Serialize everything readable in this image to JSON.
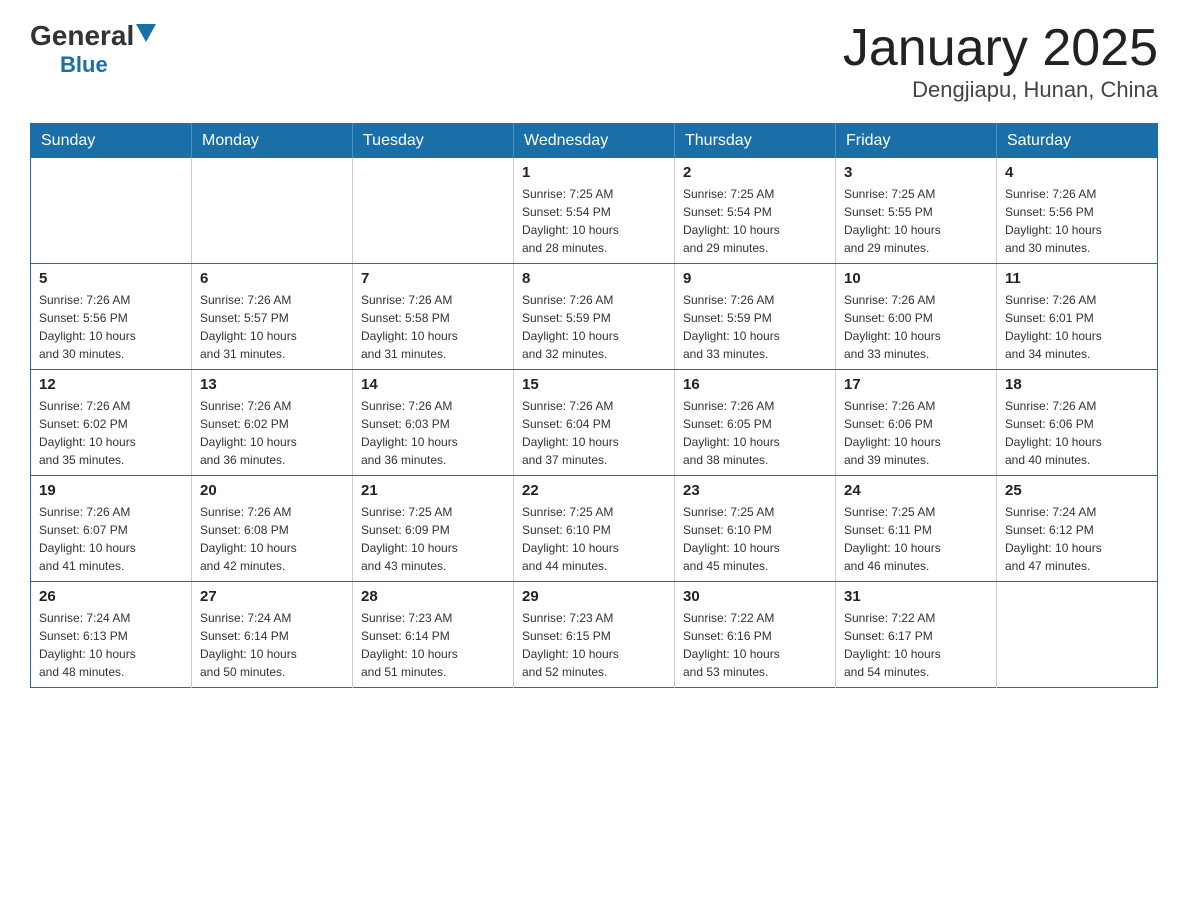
{
  "header": {
    "title": "January 2025",
    "subtitle": "Dengjiapu, Hunan, China",
    "logo_general": "General",
    "logo_blue": "Blue"
  },
  "weekdays": [
    "Sunday",
    "Monday",
    "Tuesday",
    "Wednesday",
    "Thursday",
    "Friday",
    "Saturday"
  ],
  "weeks": [
    [
      {
        "day": "",
        "info": ""
      },
      {
        "day": "",
        "info": ""
      },
      {
        "day": "",
        "info": ""
      },
      {
        "day": "1",
        "info": "Sunrise: 7:25 AM\nSunset: 5:54 PM\nDaylight: 10 hours\nand 28 minutes."
      },
      {
        "day": "2",
        "info": "Sunrise: 7:25 AM\nSunset: 5:54 PM\nDaylight: 10 hours\nand 29 minutes."
      },
      {
        "day": "3",
        "info": "Sunrise: 7:25 AM\nSunset: 5:55 PM\nDaylight: 10 hours\nand 29 minutes."
      },
      {
        "day": "4",
        "info": "Sunrise: 7:26 AM\nSunset: 5:56 PM\nDaylight: 10 hours\nand 30 minutes."
      }
    ],
    [
      {
        "day": "5",
        "info": "Sunrise: 7:26 AM\nSunset: 5:56 PM\nDaylight: 10 hours\nand 30 minutes."
      },
      {
        "day": "6",
        "info": "Sunrise: 7:26 AM\nSunset: 5:57 PM\nDaylight: 10 hours\nand 31 minutes."
      },
      {
        "day": "7",
        "info": "Sunrise: 7:26 AM\nSunset: 5:58 PM\nDaylight: 10 hours\nand 31 minutes."
      },
      {
        "day": "8",
        "info": "Sunrise: 7:26 AM\nSunset: 5:59 PM\nDaylight: 10 hours\nand 32 minutes."
      },
      {
        "day": "9",
        "info": "Sunrise: 7:26 AM\nSunset: 5:59 PM\nDaylight: 10 hours\nand 33 minutes."
      },
      {
        "day": "10",
        "info": "Sunrise: 7:26 AM\nSunset: 6:00 PM\nDaylight: 10 hours\nand 33 minutes."
      },
      {
        "day": "11",
        "info": "Sunrise: 7:26 AM\nSunset: 6:01 PM\nDaylight: 10 hours\nand 34 minutes."
      }
    ],
    [
      {
        "day": "12",
        "info": "Sunrise: 7:26 AM\nSunset: 6:02 PM\nDaylight: 10 hours\nand 35 minutes."
      },
      {
        "day": "13",
        "info": "Sunrise: 7:26 AM\nSunset: 6:02 PM\nDaylight: 10 hours\nand 36 minutes."
      },
      {
        "day": "14",
        "info": "Sunrise: 7:26 AM\nSunset: 6:03 PM\nDaylight: 10 hours\nand 36 minutes."
      },
      {
        "day": "15",
        "info": "Sunrise: 7:26 AM\nSunset: 6:04 PM\nDaylight: 10 hours\nand 37 minutes."
      },
      {
        "day": "16",
        "info": "Sunrise: 7:26 AM\nSunset: 6:05 PM\nDaylight: 10 hours\nand 38 minutes."
      },
      {
        "day": "17",
        "info": "Sunrise: 7:26 AM\nSunset: 6:06 PM\nDaylight: 10 hours\nand 39 minutes."
      },
      {
        "day": "18",
        "info": "Sunrise: 7:26 AM\nSunset: 6:06 PM\nDaylight: 10 hours\nand 40 minutes."
      }
    ],
    [
      {
        "day": "19",
        "info": "Sunrise: 7:26 AM\nSunset: 6:07 PM\nDaylight: 10 hours\nand 41 minutes."
      },
      {
        "day": "20",
        "info": "Sunrise: 7:26 AM\nSunset: 6:08 PM\nDaylight: 10 hours\nand 42 minutes."
      },
      {
        "day": "21",
        "info": "Sunrise: 7:25 AM\nSunset: 6:09 PM\nDaylight: 10 hours\nand 43 minutes."
      },
      {
        "day": "22",
        "info": "Sunrise: 7:25 AM\nSunset: 6:10 PM\nDaylight: 10 hours\nand 44 minutes."
      },
      {
        "day": "23",
        "info": "Sunrise: 7:25 AM\nSunset: 6:10 PM\nDaylight: 10 hours\nand 45 minutes."
      },
      {
        "day": "24",
        "info": "Sunrise: 7:25 AM\nSunset: 6:11 PM\nDaylight: 10 hours\nand 46 minutes."
      },
      {
        "day": "25",
        "info": "Sunrise: 7:24 AM\nSunset: 6:12 PM\nDaylight: 10 hours\nand 47 minutes."
      }
    ],
    [
      {
        "day": "26",
        "info": "Sunrise: 7:24 AM\nSunset: 6:13 PM\nDaylight: 10 hours\nand 48 minutes."
      },
      {
        "day": "27",
        "info": "Sunrise: 7:24 AM\nSunset: 6:14 PM\nDaylight: 10 hours\nand 50 minutes."
      },
      {
        "day": "28",
        "info": "Sunrise: 7:23 AM\nSunset: 6:14 PM\nDaylight: 10 hours\nand 51 minutes."
      },
      {
        "day": "29",
        "info": "Sunrise: 7:23 AM\nSunset: 6:15 PM\nDaylight: 10 hours\nand 52 minutes."
      },
      {
        "day": "30",
        "info": "Sunrise: 7:22 AM\nSunset: 6:16 PM\nDaylight: 10 hours\nand 53 minutes."
      },
      {
        "day": "31",
        "info": "Sunrise: 7:22 AM\nSunset: 6:17 PM\nDaylight: 10 hours\nand 54 minutes."
      },
      {
        "day": "",
        "info": ""
      }
    ]
  ]
}
